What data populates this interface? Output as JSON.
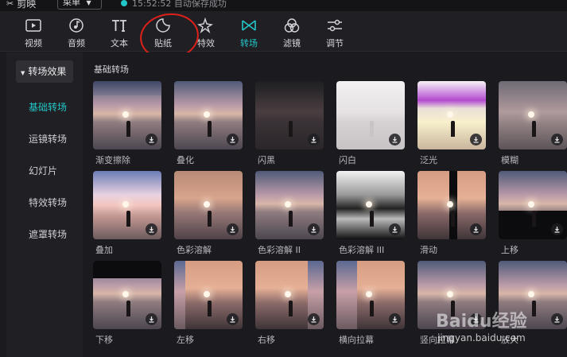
{
  "app": {
    "name": "剪映",
    "menu_label": "菜单",
    "save_status": "15:52:52 自动保存成功"
  },
  "toolbar": [
    {
      "label": "视频",
      "icon": "video-icon"
    },
    {
      "label": "音频",
      "icon": "audio-icon"
    },
    {
      "label": "文本",
      "icon": "text-icon"
    },
    {
      "label": "贴纸",
      "icon": "sticker-icon"
    },
    {
      "label": "特效",
      "icon": "effects-icon"
    },
    {
      "label": "转场",
      "icon": "transition-icon"
    },
    {
      "label": "滤镜",
      "icon": "filter-icon"
    },
    {
      "label": "调节",
      "icon": "adjust-icon"
    }
  ],
  "active_tool": "转场",
  "sidebar": {
    "header": "转场效果",
    "items": [
      {
        "label": "基础转场"
      },
      {
        "label": "运镜转场"
      },
      {
        "label": "幻灯片"
      },
      {
        "label": "特效转场"
      },
      {
        "label": "遮罩转场"
      }
    ]
  },
  "section": {
    "title": "基础转场"
  },
  "tiles": [
    {
      "name": "渐变擦除"
    },
    {
      "name": "叠化"
    },
    {
      "name": "闪黑"
    },
    {
      "name": "闪白"
    },
    {
      "name": "泛光"
    },
    {
      "name": "模糊"
    },
    {
      "name": "叠加"
    },
    {
      "name": "色彩溶解"
    },
    {
      "name": "色彩溶解 II"
    },
    {
      "name": "色彩溶解 III"
    },
    {
      "name": "滑动"
    },
    {
      "name": "上移"
    },
    {
      "name": "下移"
    },
    {
      "name": "左移"
    },
    {
      "name": "右移"
    },
    {
      "name": "横向拉幕"
    },
    {
      "name": "竖向拉幕"
    },
    {
      "name": "放大"
    }
  ],
  "watermark": {
    "brand": "Baidu经验",
    "url": "jingyan.baidu.com"
  },
  "colors": {
    "accent": "#23c6c8",
    "annotation": "#e0201a",
    "background": "#1b1b1f",
    "panel": "#202024"
  }
}
